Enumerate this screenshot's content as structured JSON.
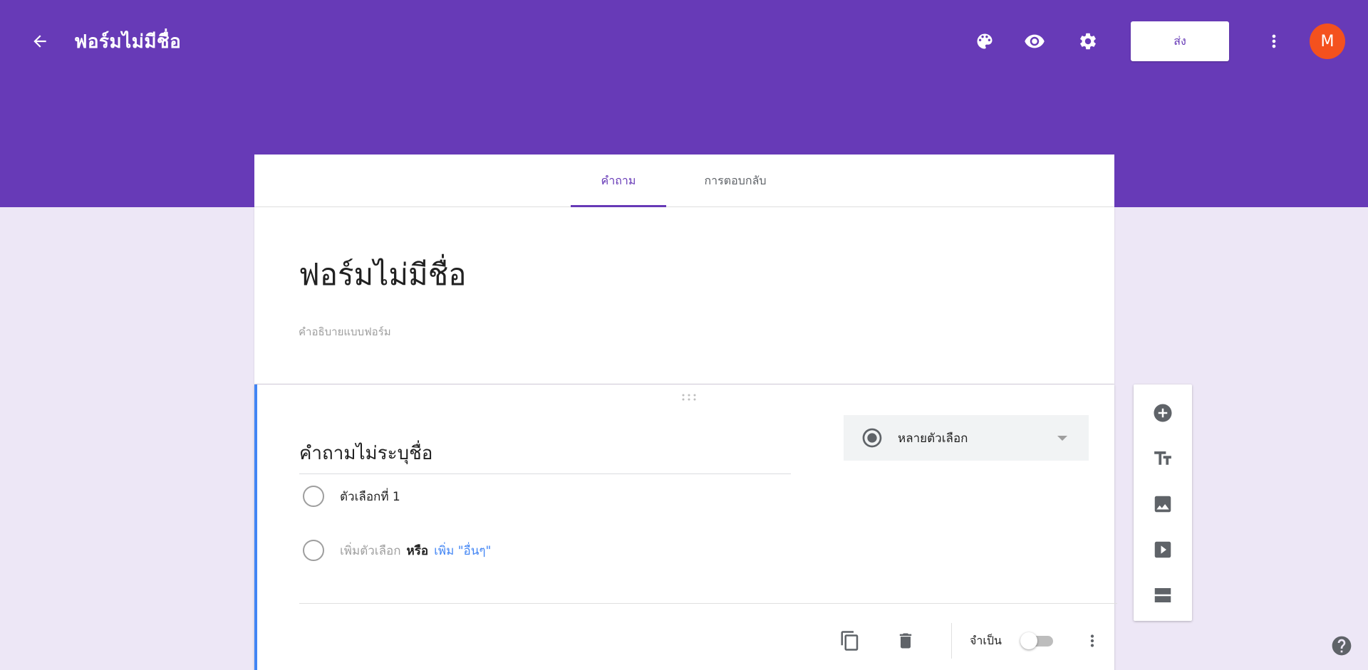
{
  "app_bar": {
    "title": "ฟอร์มไม่มีชื่อ",
    "send_label": "ส่ง",
    "avatar_letter": "M",
    "icons": [
      "arrow-left-icon",
      "palette-icon",
      "eye-icon",
      "gear-icon",
      "more-vert-icon"
    ]
  },
  "tabs": {
    "questions_label": "คำถาม",
    "responses_label": "การตอบกลับ"
  },
  "form": {
    "title": "ฟอร์มไม่มีชื่อ",
    "description_placeholder": "คำอธิบายแบบฟอร์ม"
  },
  "question": {
    "title": "คำถามไม่ระบุชื่อ",
    "type_label": "หลายตัวเลือก",
    "option_1": "ตัวเลือกที่ 1",
    "add_option": "เพิ่มตัวเลือก",
    "or_text": "หรือ",
    "add_other": "เพิ่ม \"อื่นๆ\"",
    "required_label": "จำเป็น",
    "required_on": false
  },
  "side_toolbar": {
    "icons": [
      "add-circle-icon",
      "title-text-icon",
      "image-icon",
      "video-icon",
      "section-icon"
    ]
  },
  "colors": {
    "brand": "#673ab7",
    "page_bg": "#ede7f6",
    "accent_blue": "#4285f4",
    "avatar": "#f4511e"
  }
}
